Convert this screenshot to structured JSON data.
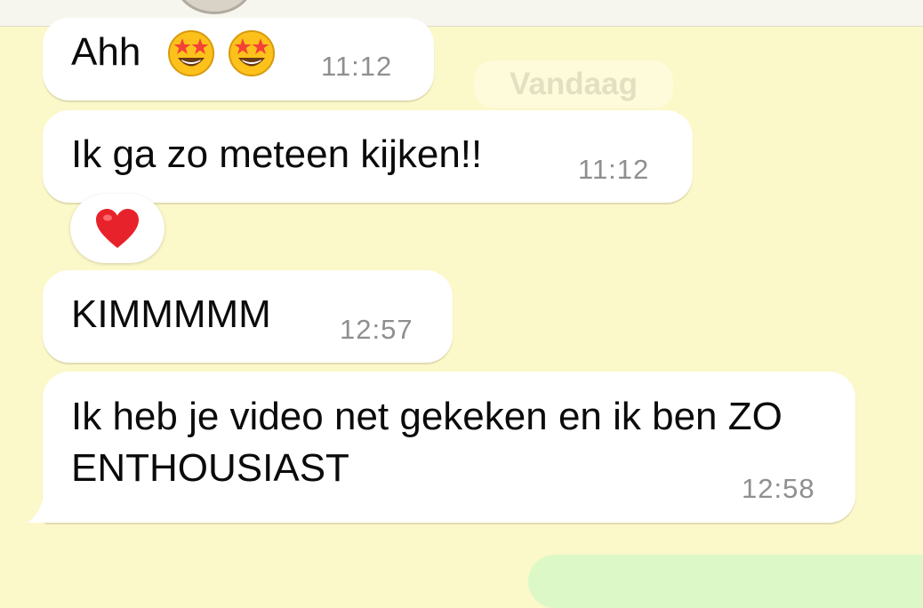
{
  "chat": {
    "date_separator": "Vandaag",
    "messages": [
      {
        "text": "Ahh",
        "emojis": [
          "star-struck-emoji",
          "star-struck-emoji"
        ],
        "time": "11:12"
      },
      {
        "text": "Ik ga zo meteen kijken!!",
        "time": "11:12",
        "reaction": "red-heart-emoji"
      },
      {
        "text": "KIMMMMM",
        "time": "12:57"
      },
      {
        "text": "Ik heb je video net gekeken en ik ben ZO ENTHOUSIAST",
        "time": "12:58"
      }
    ]
  },
  "colors": {
    "chat_background": "#fbf8c9",
    "incoming_bubble": "#ffffff",
    "outgoing_bubble": "#dcf8c6",
    "timestamp_text": "#8f8f8f",
    "date_chip_text": "#e3e0c2"
  }
}
